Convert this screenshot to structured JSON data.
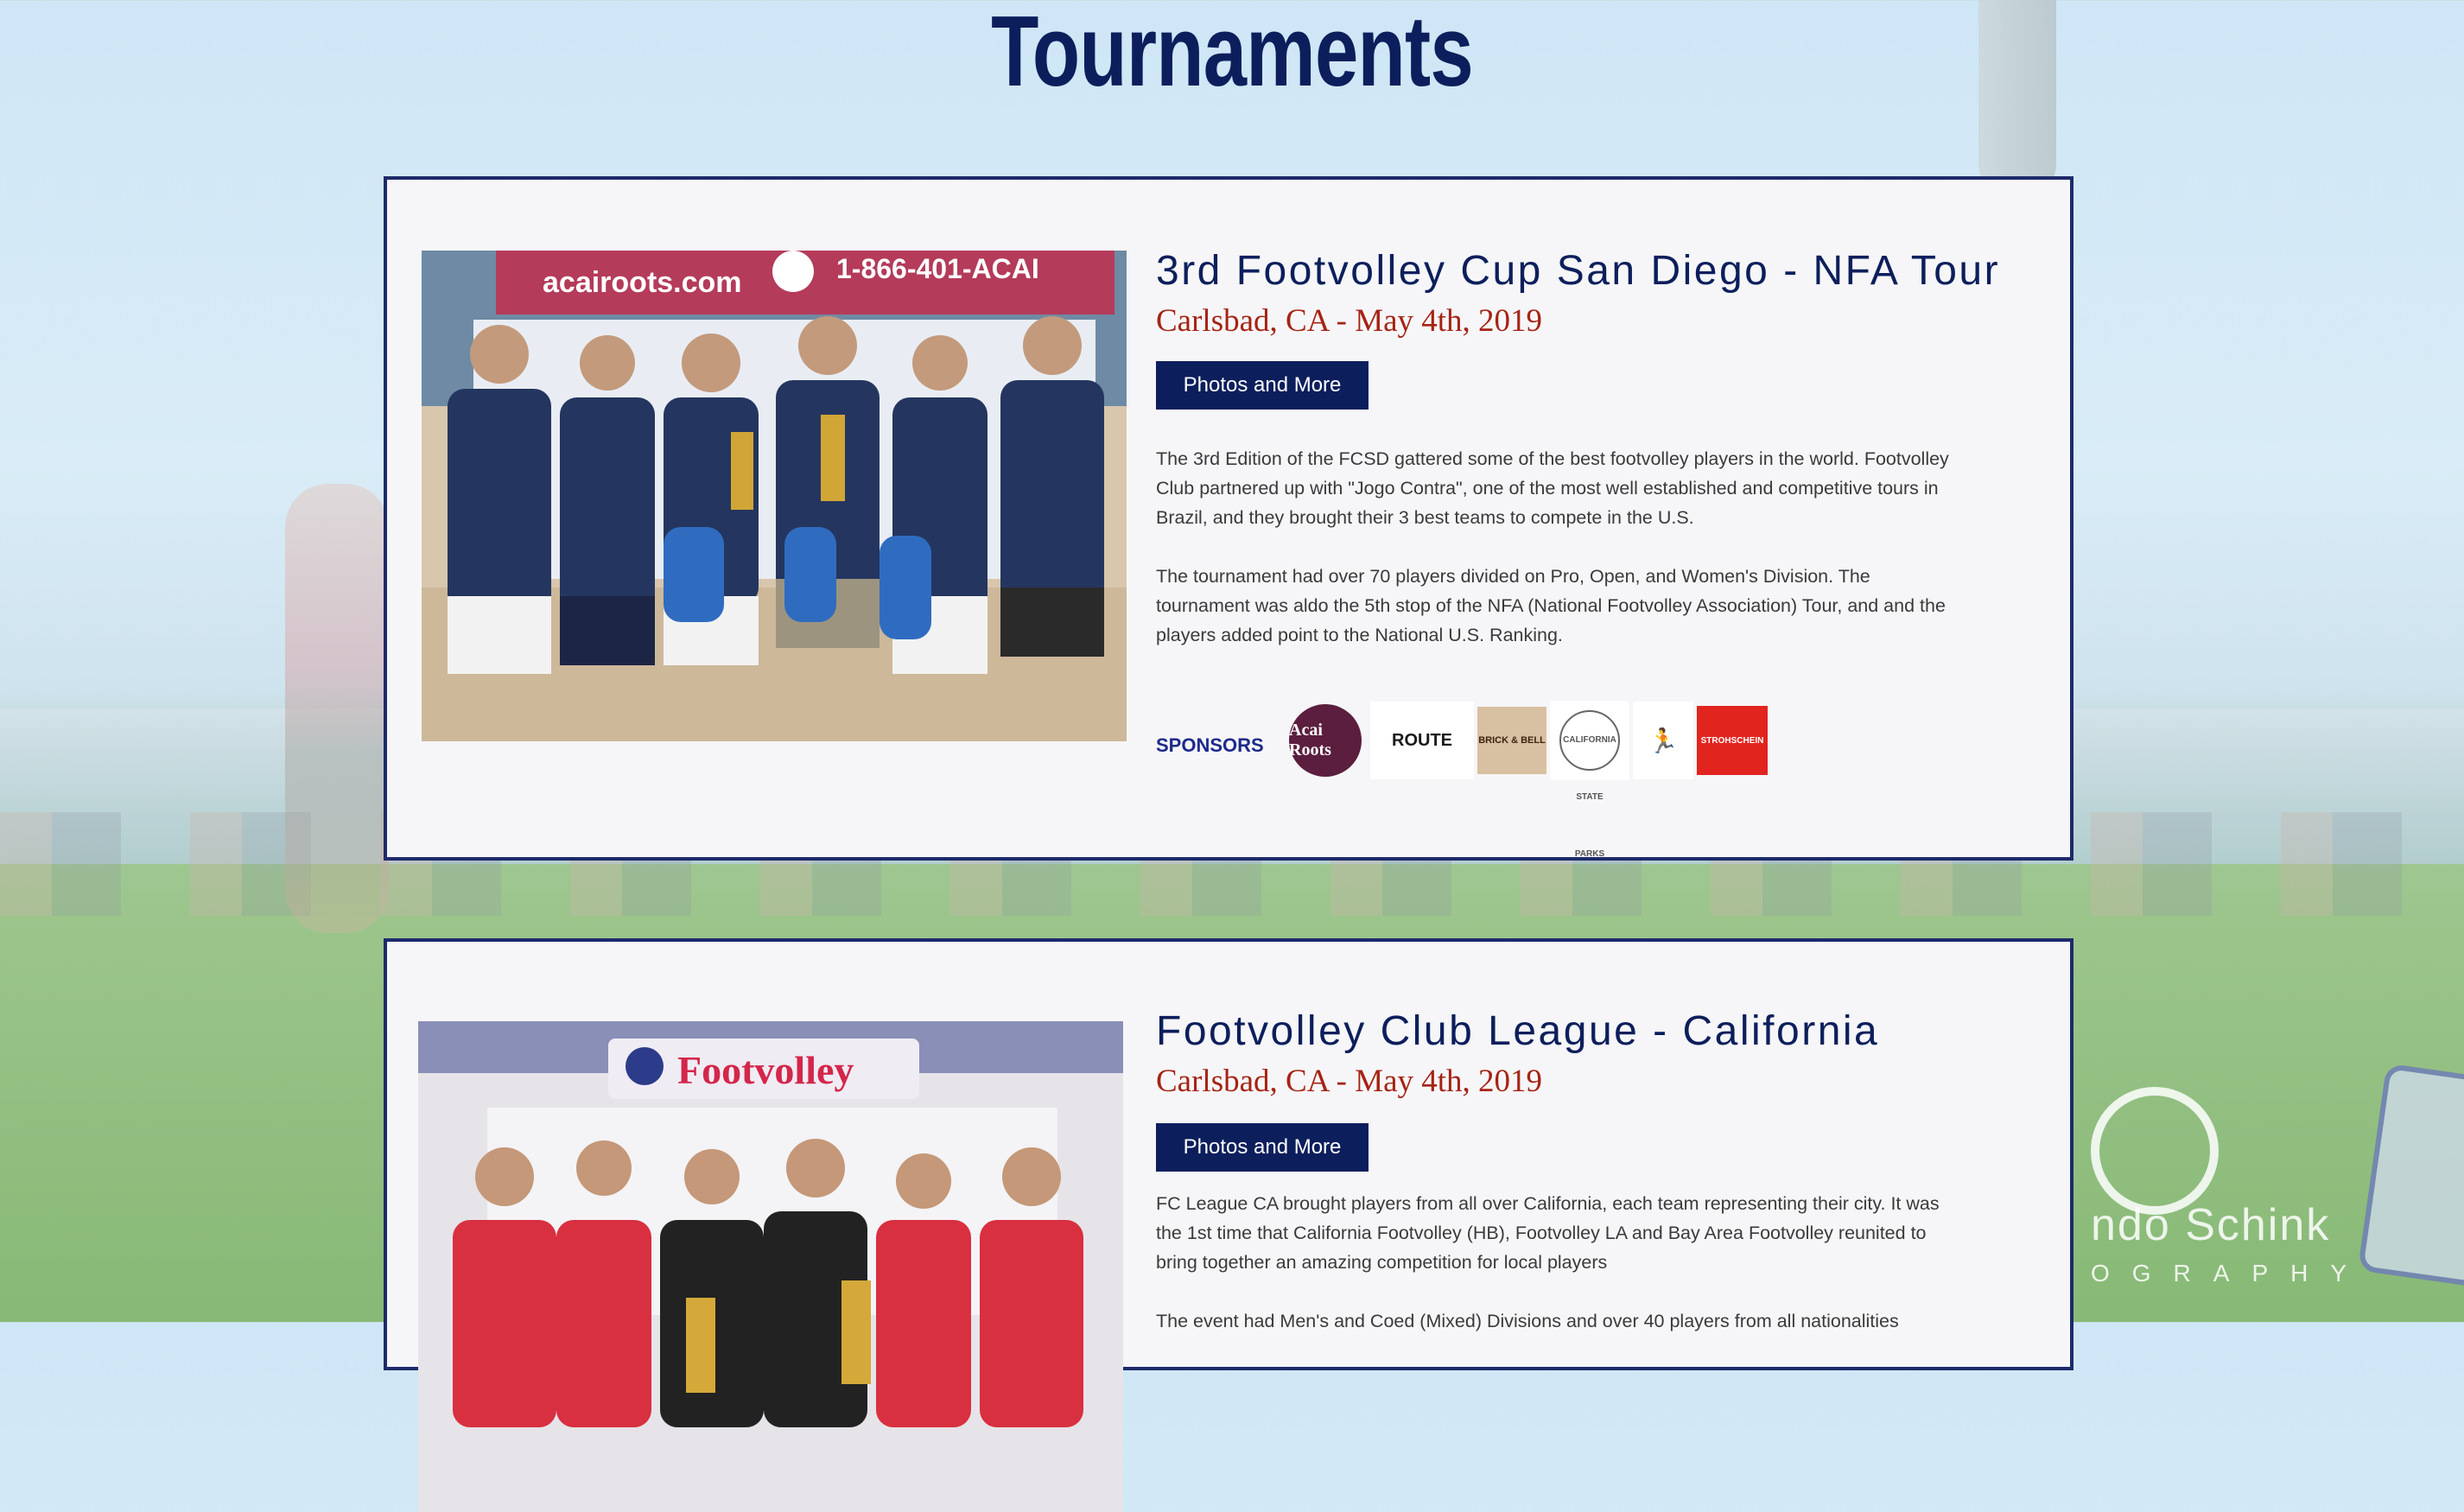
{
  "page": {
    "title": "Tournaments"
  },
  "tournaments": [
    {
      "title": "3rd Footvolley Cup San Diego - NFA Tour",
      "location_date": "Carlsbad, CA  - May 4th, 2019",
      "button_label": "Photos and More",
      "paragraphs": [
        "The 3rd Edition of the FCSD gattered some of the best footvolley players in the world. Footvolley Club partnered up with \"Jogo Contra\", one of the most well established and competitive tours in Brazil, and they brought their 3 best teams to compete in the U.S.",
        "The tournament had over 70 players divided on Pro, Open, and Women's Division. The tournament was aldo the 5th stop of the NFA (National Footvolley Association) Tour, and and the players added point to the National U.S. Ranking."
      ],
      "sponsors_label": "SPONSORS",
      "sponsors": [
        "Acai Roots",
        "ROUTE",
        "BRICK & BELL",
        "CALIFORNIA STATE PARKS",
        "STROHSCHEIN"
      ],
      "photo_banner": "acairoots.com",
      "photo_phone": "1-866-401-ACAI"
    },
    {
      "title": "Footvolley Club League - California",
      "location_date": "Carlsbad, CA  - May 4th, 2019",
      "button_label": "Photos and More",
      "paragraphs": [
        "FC League CA brought players from all over California, each team representing their city. It was the 1st time that California Footvolley (HB), Footvolley LA and Bay Area Footvolley reunited to bring together an amazing competition for local players",
        "The event had Men's and Coed (Mixed) Divisions and over 40 players from all nationalities"
      ],
      "photo_banner": "Footvolley"
    }
  ],
  "watermark": {
    "name": "ndo  Schink",
    "sub": "OGRAPHY"
  },
  "colors": {
    "title_navy": "#0c1f5c",
    "subtitle_red": "#a52414",
    "card_border": "#1d2a6b",
    "card_bg": "#f6f6f8"
  }
}
